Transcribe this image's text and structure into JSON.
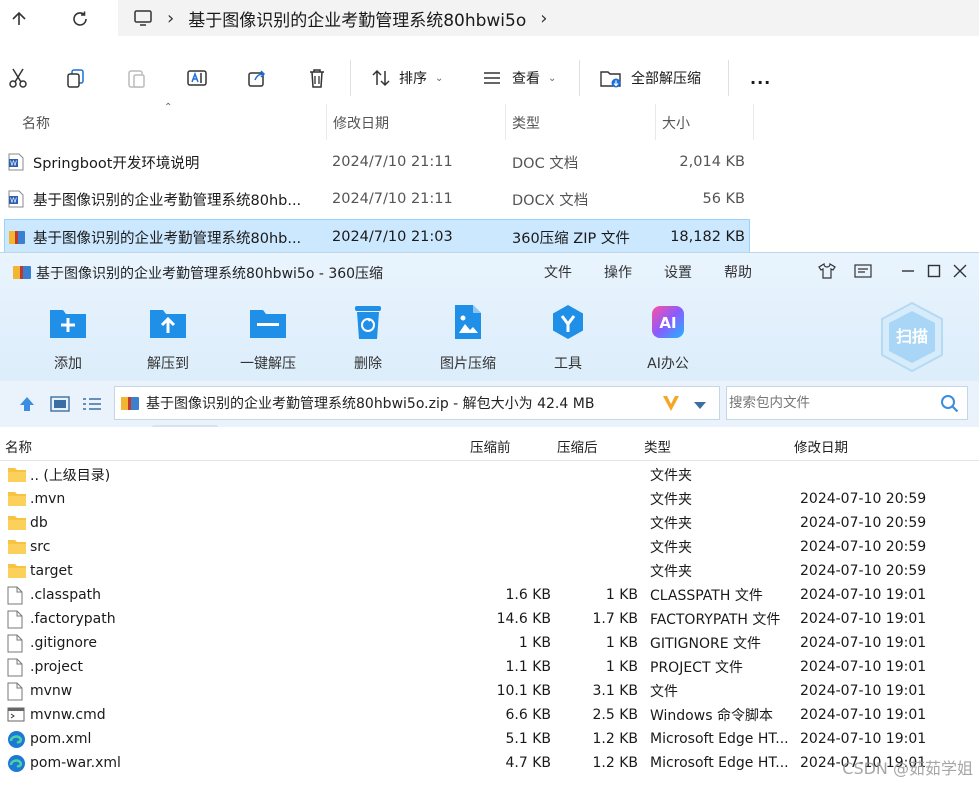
{
  "explorer": {
    "breadcrumb": "基于图像识别的企业考勤管理系统80hbwi5o",
    "commands": {
      "sort": "排序",
      "view": "查看",
      "extract_all": "全部解压缩",
      "more": "..."
    },
    "columns": {
      "name": "名称",
      "date": "修改日期",
      "type": "类型",
      "size": "大小"
    },
    "files": [
      {
        "name": "Springboot开发环境说明",
        "date": "2024/7/10 21:11",
        "type": "DOC 文档",
        "size": "2,014 KB",
        "icon": "word-doc-icon"
      },
      {
        "name": "基于图像识别的企业考勤管理系统80hb...",
        "date": "2024/7/10 21:11",
        "type": "DOCX 文档",
        "size": "56 KB",
        "icon": "word-doc-icon"
      },
      {
        "name": "基于图像识别的企业考勤管理系统80hb...",
        "date": "2024/7/10 21:03",
        "type": "360压缩 ZIP 文件",
        "size": "18,182 KB",
        "icon": "zip-archive-icon",
        "selected": true
      }
    ]
  },
  "zip": {
    "title": "基于图像识别的企业考勤管理系统80hbwi5o - 360压缩",
    "menu": [
      "文件",
      "操作",
      "设置",
      "帮助"
    ],
    "toolbar": [
      "添加",
      "解压到",
      "一键解压",
      "删除",
      "图片压缩",
      "工具",
      "AI办公"
    ],
    "ai_badge": "AI",
    "scan_label": "扫描",
    "path": "基于图像识别的企业考勤管理系统80hbwi5o.zip - 解包大小为 42.4 MB",
    "search_placeholder": "搜索包内文件",
    "columns": {
      "name": "名称",
      "before": "压缩前",
      "after": "压缩后",
      "type": "类型",
      "date": "修改日期"
    },
    "rows": [
      {
        "name": ".. (上级目录)",
        "before": "",
        "after": "",
        "type": "文件夹",
        "date": "",
        "icon": "folder-icon"
      },
      {
        "name": ".mvn",
        "before": "",
        "after": "",
        "type": "文件夹",
        "date": "2024-07-10 20:59",
        "icon": "folder-icon"
      },
      {
        "name": "db",
        "before": "",
        "after": "",
        "type": "文件夹",
        "date": "2024-07-10 20:59",
        "icon": "folder-icon"
      },
      {
        "name": "src",
        "before": "",
        "after": "",
        "type": "文件夹",
        "date": "2024-07-10 20:59",
        "icon": "folder-icon"
      },
      {
        "name": "target",
        "before": "",
        "after": "",
        "type": "文件夹",
        "date": "2024-07-10 20:59",
        "icon": "folder-icon"
      },
      {
        "name": ".classpath",
        "before": "1.6 KB",
        "after": "1 KB",
        "type": "CLASSPATH 文件",
        "date": "2024-07-10 19:01",
        "icon": "file-icon"
      },
      {
        "name": ".factorypath",
        "before": "14.6 KB",
        "after": "1.7 KB",
        "type": "FACTORYPATH 文件",
        "date": "2024-07-10 19:01",
        "icon": "file-icon"
      },
      {
        "name": ".gitignore",
        "before": "1 KB",
        "after": "1 KB",
        "type": "GITIGNORE 文件",
        "date": "2024-07-10 19:01",
        "icon": "file-icon"
      },
      {
        "name": ".project",
        "before": "1.1 KB",
        "after": "1 KB",
        "type": "PROJECT 文件",
        "date": "2024-07-10 19:01",
        "icon": "file-icon"
      },
      {
        "name": "mvnw",
        "before": "10.1 KB",
        "after": "3.1 KB",
        "type": "文件",
        "date": "2024-07-10 19:01",
        "icon": "file-icon"
      },
      {
        "name": "mvnw.cmd",
        "before": "6.6 KB",
        "after": "2.5 KB",
        "type": "Windows 命令脚本",
        "date": "2024-07-10 19:01",
        "icon": "cmd-script-icon"
      },
      {
        "name": "pom.xml",
        "before": "5.1 KB",
        "after": "1.2 KB",
        "type": "Microsoft Edge HT...",
        "date": "2024-07-10 19:01",
        "icon": "edge-icon"
      },
      {
        "name": "pom-war.xml",
        "before": "4.7 KB",
        "after": "1.2 KB",
        "type": "Microsoft Edge HT...",
        "date": "2024-07-10 19:01",
        "icon": "edge-icon"
      }
    ]
  },
  "watermark": "CSDN @茹茹学姐"
}
